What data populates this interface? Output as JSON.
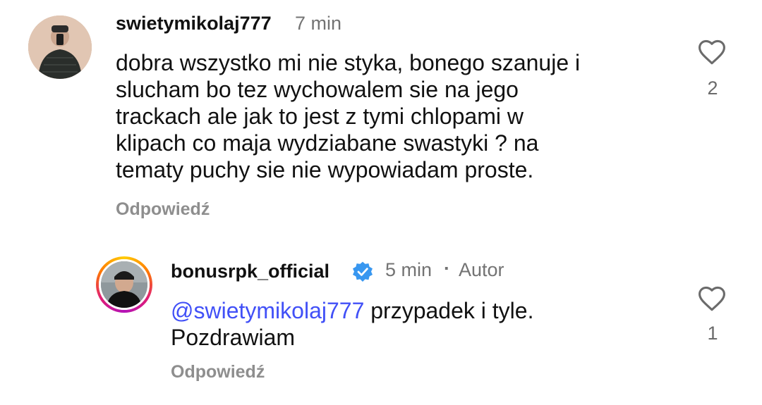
{
  "comments": [
    {
      "username": "swietymikolaj777",
      "time": "7 min",
      "text": "dobra wszystko mi nie styka, bonego szanuje i slucham bo tez wychowalem sie na jego trackach ale jak to jest z tymi chlopami w klipach co maja wydziabane swastyki ? na tematy puchy sie nie wypowiadam proste.",
      "text_lines": [
        "dobra wszystko mi nie styka, bonego szanuje i",
        "slucham bo tez wychowalem sie na jego",
        "trackach ale jak to jest z tymi chlopami w",
        "klipach co maja wydziabane swastyki ? na",
        "tematy puchy sie nie wypowiadam proste."
      ],
      "reply_label": "Odpowiedź",
      "like_count": "2",
      "avatar_icon": "profile-photo",
      "like_icon": "heart-outline-icon"
    },
    {
      "username": "bonusrpk_official",
      "verified": true,
      "time": "5 min",
      "separator": "·",
      "author_tag": "Autor",
      "mention": "@swietymikolaj777",
      "text_line1_rest": " przypadek i tyle.",
      "text_line2": "Pozdrawiam",
      "reply_label": "Odpowiedź",
      "like_count": "1",
      "avatar_icon": "profile-photo-story-ring",
      "like_icon": "heart-outline-icon"
    }
  ],
  "colors": {
    "mention": "#4150f7",
    "verified": "#3897f0",
    "muted": "#737373"
  }
}
